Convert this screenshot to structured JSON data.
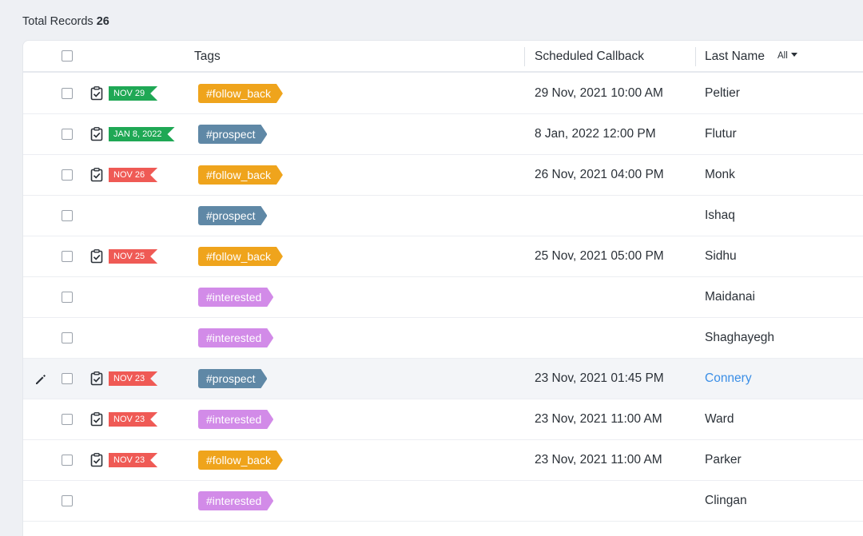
{
  "summary": {
    "label": "Total Records",
    "count": "26"
  },
  "header": {
    "tags": "Tags",
    "scheduled_callback": "Scheduled Callback",
    "last_name": "Last Name",
    "last_name_filter": "All"
  },
  "colors": {
    "badge_green": "#1fa855",
    "badge_red": "#ef5a55",
    "tag_follow_back": "#efa41c",
    "tag_prospect": "#5f88a6",
    "tag_interested": "#d28be8",
    "link": "#3a8ee6"
  },
  "icons": {
    "task": "task-checkbox-icon",
    "edit": "pencil-icon",
    "filter": "caret-down-icon"
  },
  "rows": [
    {
      "task": true,
      "date_badge": "NOV 29",
      "badge_color": "green",
      "tag": "#follow_back",
      "tag_type": "follow_back",
      "callback": "29 Nov, 2021 10:00 AM",
      "last_name": "Peltier"
    },
    {
      "task": true,
      "date_badge": "JAN 8, 2022",
      "badge_color": "green",
      "tag": "#prospect",
      "tag_type": "prospect",
      "callback": "8 Jan, 2022 12:00 PM",
      "last_name": "Flutur"
    },
    {
      "task": true,
      "date_badge": "NOV 26",
      "badge_color": "red",
      "tag": "#follow_back",
      "tag_type": "follow_back",
      "callback": "26 Nov, 2021 04:00 PM",
      "last_name": "Monk"
    },
    {
      "task": false,
      "date_badge": "",
      "badge_color": "",
      "tag": "#prospect",
      "tag_type": "prospect",
      "callback": "",
      "last_name": "Ishaq"
    },
    {
      "task": true,
      "date_badge": "NOV 25",
      "badge_color": "red",
      "tag": "#follow_back",
      "tag_type": "follow_back",
      "callback": "25 Nov, 2021 05:00 PM",
      "last_name": "Sidhu"
    },
    {
      "task": false,
      "date_badge": "",
      "badge_color": "",
      "tag": "#interested",
      "tag_type": "interested",
      "callback": "",
      "last_name": "Maidanai"
    },
    {
      "task": false,
      "date_badge": "",
      "badge_color": "",
      "tag": "#interested",
      "tag_type": "interested",
      "callback": "",
      "last_name": "Shaghayegh"
    },
    {
      "task": true,
      "date_badge": "NOV 23",
      "badge_color": "red",
      "tag": "#prospect",
      "tag_type": "prospect",
      "callback": "23 Nov, 2021 01:45 PM",
      "last_name": "Connery",
      "active": true
    },
    {
      "task": true,
      "date_badge": "NOV 23",
      "badge_color": "red",
      "tag": "#interested",
      "tag_type": "interested",
      "callback": "23 Nov, 2021 11:00 AM",
      "last_name": "Ward"
    },
    {
      "task": true,
      "date_badge": "NOV 23",
      "badge_color": "red",
      "tag": "#follow_back",
      "tag_type": "follow_back",
      "callback": "23 Nov, 2021 11:00 AM",
      "last_name": "Parker"
    },
    {
      "task": false,
      "date_badge": "",
      "badge_color": "",
      "tag": "#interested",
      "tag_type": "interested",
      "callback": "",
      "last_name": "Clingan"
    }
  ]
}
